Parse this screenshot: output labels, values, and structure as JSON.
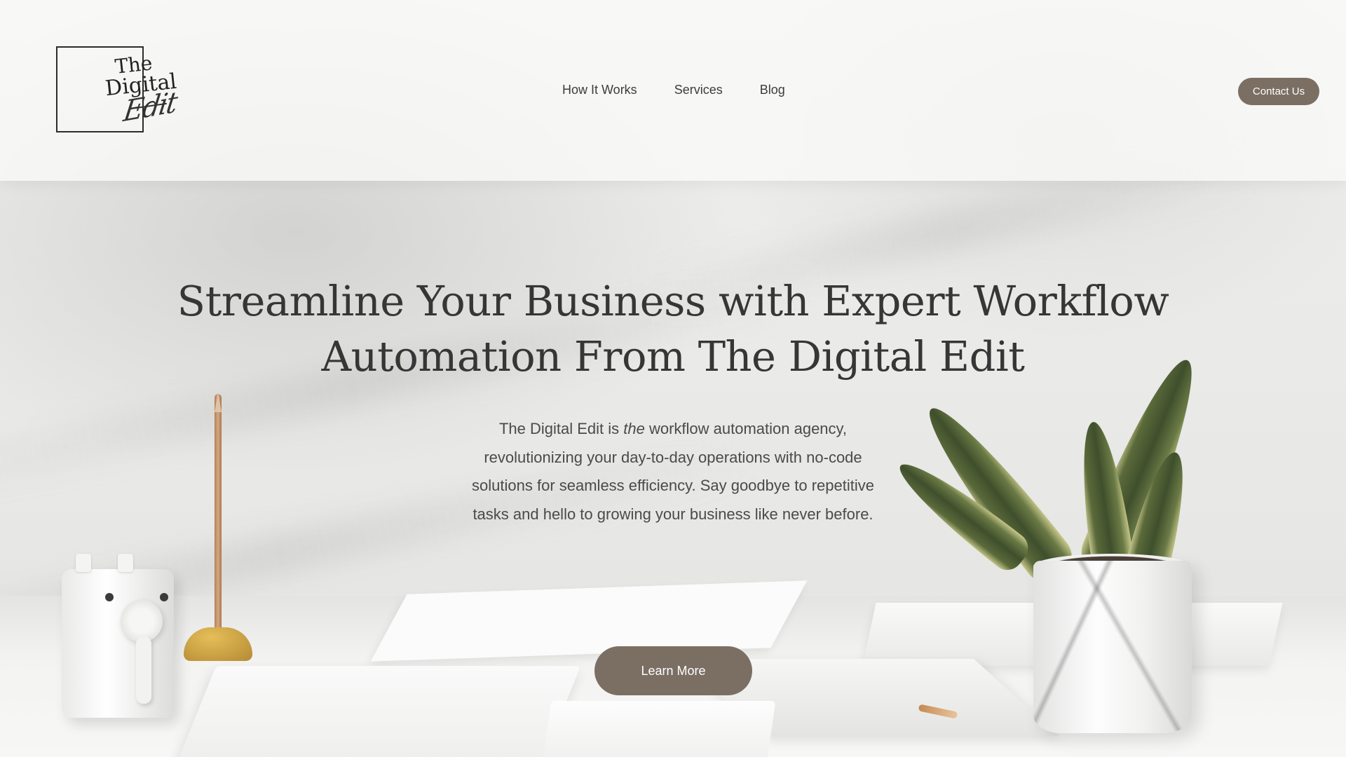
{
  "header": {
    "logo": {
      "line1": "The",
      "line2": "Digital",
      "line3": "Edit"
    },
    "nav": [
      {
        "label": "How It Works"
      },
      {
        "label": "Services"
      },
      {
        "label": "Blog"
      }
    ],
    "contact_label": "Contact Us"
  },
  "hero": {
    "title_line1": "Streamline Your Business with Expert Workflow",
    "title_line2": "Automation From The Digital Edit",
    "text_before": "The Digital Edit is ",
    "text_emphasis": "the",
    "text_after": " workflow automation agency, revolutionizing your day-to-day operations with no-code solutions for seamless efficiency. Say goodbye to repetitive tasks and hello to growing your business like never before.",
    "cta_label": "Learn More"
  },
  "colors": {
    "accent": "#7b6f64",
    "text": "#363636",
    "background": "#ececea"
  }
}
